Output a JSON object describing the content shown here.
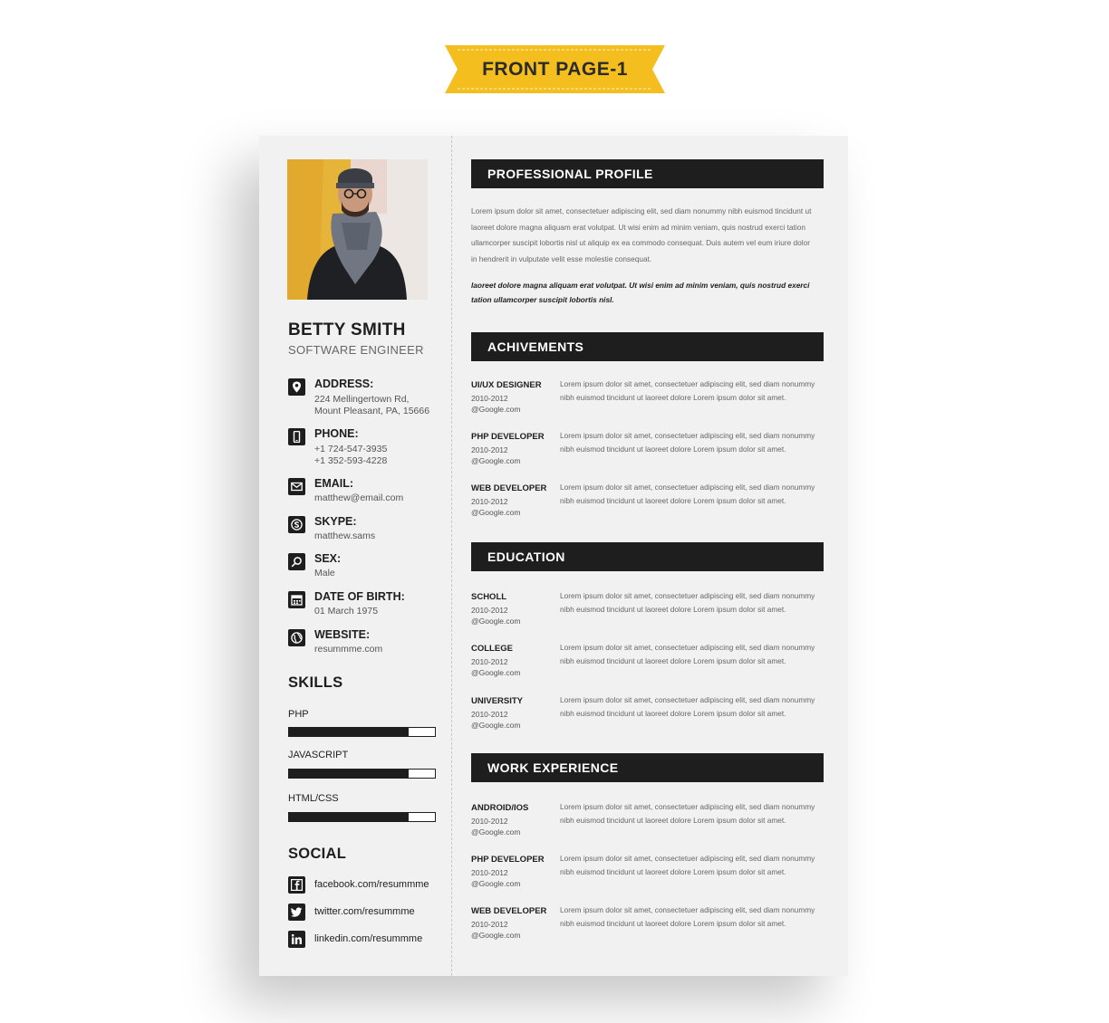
{
  "banner": {
    "label": "FRONT PAGE-1",
    "color": "#f5be1f"
  },
  "resume": {
    "name": "BETTY SMITH",
    "role": "SOFTWARE ENGINEER",
    "contacts": [
      {
        "icon": "map-pin-icon",
        "label": "ADDRESS:",
        "lines": [
          "224 Mellingertown Rd,",
          "Mount Pleasant, PA, 15666"
        ]
      },
      {
        "icon": "phone-icon",
        "label": "PHONE:",
        "lines": [
          "+1 724-547-3935",
          "+1 352-593-4228"
        ]
      },
      {
        "icon": "email-icon",
        "label": "EMAIL:",
        "lines": [
          "matthew@email.com"
        ]
      },
      {
        "icon": "skype-icon",
        "label": "SKYPE:",
        "lines": [
          "matthew.sams"
        ]
      },
      {
        "icon": "gender-icon",
        "label": "SEX:",
        "lines": [
          "Male"
        ]
      },
      {
        "icon": "calendar-icon",
        "label": "DATE OF BIRTH:",
        "lines": [
          "01 March 1975"
        ]
      },
      {
        "icon": "globe-icon",
        "label": "WEBSITE:",
        "lines": [
          "resummme.com"
        ]
      }
    ],
    "skills_title": "SKILLS",
    "skills": [
      {
        "name": "PHP",
        "level": 0.82
      },
      {
        "name": "JAVASCRIPT",
        "level": 0.82
      },
      {
        "name": "HTML/CSS",
        "level": 0.82
      }
    ],
    "social_title": "SOCIAL",
    "social": [
      {
        "icon": "facebook-icon",
        "text": "facebook.com/resummme"
      },
      {
        "icon": "twitter-icon",
        "text": "twitter.com/resummme"
      },
      {
        "icon": "linkedin-icon",
        "text": "linkedin.com/resummme"
      }
    ],
    "profile": {
      "heading": "PROFESSIONAL PROFILE",
      "text": "Lorem ipsum dolor sit amet, consectetuer adipiscing elit, sed diam nonummy nibh euismod tincidunt ut laoreet dolore magna aliquam erat volutpat. Ut wisi enim ad minim veniam, quis nostrud exerci tation ullamcorper suscipit lobortis nisl ut aliquip ex ea commodo consequat. Duis autem vel eum iriure dolor in hendrerit in vulputate velit esse molestie consequat.",
      "emphasis": "laoreet dolore magna aliquam erat volutpat. Ut wisi enim ad minim veniam, quis nostrud exerci tation ullamcorper suscipit lobortis nisl."
    },
    "achievements": {
      "heading": "ACHIVEMENTS",
      "items": [
        {
          "title": "UI/UX DESIGNER",
          "years": "2010-2012",
          "org": "@Google.com",
          "desc": "Lorem ipsum dolor sit amet, consectetuer adipiscing elit, sed diam nonummy nibh euismod tincidunt ut laoreet dolore Lorem ipsum dolor sit amet."
        },
        {
          "title": "PHP DEVELOPER",
          "years": "2010-2012",
          "org": "@Google.com",
          "desc": "Lorem ipsum dolor sit amet, consectetuer adipiscing elit, sed diam nonummy nibh euismod tincidunt ut laoreet dolore Lorem ipsum dolor sit amet."
        },
        {
          "title": "WEB DEVELOPER",
          "years": "2010-2012",
          "org": "@Google.com",
          "desc": "Lorem ipsum dolor sit amet, consectetuer adipiscing elit, sed diam nonummy nibh euismod tincidunt ut laoreet dolore Lorem ipsum dolor sit amet."
        }
      ]
    },
    "education": {
      "heading": "EDUCATION",
      "items": [
        {
          "title": "SCHOLL",
          "years": "2010-2012",
          "org": "@Google.com",
          "desc": "Lorem ipsum dolor sit amet, consectetuer adipiscing elit, sed diam nonummy nibh euismod tincidunt ut laoreet dolore Lorem ipsum dolor sit amet."
        },
        {
          "title": "COLLEGE",
          "years": "2010-2012",
          "org": "@Google.com",
          "desc": "Lorem ipsum dolor sit amet, consectetuer adipiscing elit, sed diam nonummy nibh euismod tincidunt ut laoreet dolore Lorem ipsum dolor sit amet."
        },
        {
          "title": "UNIVERSITY",
          "years": "2010-2012",
          "org": "@Google.com",
          "desc": "Lorem ipsum dolor sit amet, consectetuer adipiscing elit, sed diam nonummy nibh euismod tincidunt ut laoreet dolore Lorem ipsum dolor sit amet."
        }
      ]
    },
    "experience": {
      "heading": "WORK EXPERIENCE",
      "items": [
        {
          "title": "ANDROID/IOS",
          "years": "2010-2012",
          "org": "@Google.com",
          "desc": "Lorem ipsum dolor sit amet, consectetuer adipiscing elit, sed diam nonummy nibh euismod tincidunt ut laoreet dolore Lorem ipsum dolor sit amet."
        },
        {
          "title": "PHP DEVELOPER",
          "years": "2010-2012",
          "org": "@Google.com",
          "desc": "Lorem ipsum dolor sit amet, consectetuer adipiscing elit, sed diam nonummy nibh euismod tincidunt ut laoreet dolore Lorem ipsum dolor sit amet."
        },
        {
          "title": "WEB DEVELOPER",
          "years": "2010-2012",
          "org": "@Google.com",
          "desc": "Lorem ipsum dolor sit amet, consectetuer adipiscing elit, sed diam nonummy nibh euismod tincidunt ut laoreet dolore Lorem ipsum dolor sit amet."
        }
      ]
    }
  }
}
